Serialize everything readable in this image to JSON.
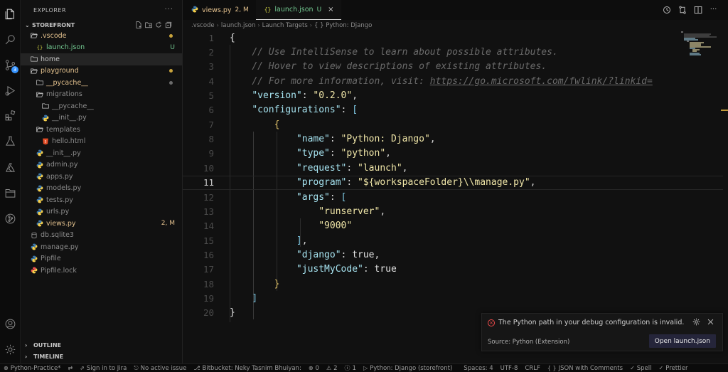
{
  "sidebar": {
    "title": "EXPLORER",
    "more": "···",
    "project": "STOREFRONT",
    "items": [
      {
        "label": ".vscode",
        "kind": "folder-open",
        "depth": 0,
        "color": "mod",
        "dot": "#c9a43c"
      },
      {
        "label": "launch.json",
        "kind": "json",
        "depth": 1,
        "color": "untracked",
        "status": "U",
        "statusColor": "#73c991"
      },
      {
        "label": "home",
        "kind": "folder",
        "depth": 0,
        "color": "normal",
        "selected": true
      },
      {
        "label": "playground",
        "kind": "folder-open",
        "depth": 0,
        "color": "mod",
        "dot": "#c9a43c"
      },
      {
        "label": "__pycache__",
        "kind": "folder",
        "depth": 1,
        "color": "mod",
        "dot": "#6b6b6b"
      },
      {
        "label": "migrations",
        "kind": "folder-open",
        "depth": 1,
        "color": "dim"
      },
      {
        "label": "__pycache__",
        "kind": "folder",
        "depth": 2,
        "color": "dim"
      },
      {
        "label": "__init__.py",
        "kind": "py",
        "depth": 2,
        "color": "dim"
      },
      {
        "label": "templates",
        "kind": "folder-open",
        "depth": 1,
        "color": "dim"
      },
      {
        "label": "hello.html",
        "kind": "html",
        "depth": 2,
        "color": "dim"
      },
      {
        "label": "__init__.py",
        "kind": "py",
        "depth": 1,
        "color": "dim"
      },
      {
        "label": "admin.py",
        "kind": "py",
        "depth": 1,
        "color": "dim"
      },
      {
        "label": "apps.py",
        "kind": "py",
        "depth": 1,
        "color": "dim"
      },
      {
        "label": "models.py",
        "kind": "py",
        "depth": 1,
        "color": "dim"
      },
      {
        "label": "tests.py",
        "kind": "py",
        "depth": 1,
        "color": "dim"
      },
      {
        "label": "urls.py",
        "kind": "py",
        "depth": 1,
        "color": "dim"
      },
      {
        "label": "views.py",
        "kind": "py",
        "depth": 1,
        "color": "mod",
        "status": "2, M",
        "statusColor": "#e2c08d"
      },
      {
        "label": "db.sqlite3",
        "kind": "db",
        "depth": 0,
        "color": "dim"
      },
      {
        "label": "manage.py",
        "kind": "py",
        "depth": 0,
        "color": "dim"
      },
      {
        "label": "Pipfile",
        "kind": "pip",
        "depth": 0,
        "color": "dim"
      },
      {
        "label": "Pipfile.lock",
        "kind": "lock",
        "depth": 0,
        "color": "dim"
      }
    ],
    "outline": "OUTLINE",
    "timeline": "TIMELINE"
  },
  "activity": {
    "scm_badge": "3"
  },
  "tabs": [
    {
      "label": "views.py",
      "status": "2, M",
      "icon": "py",
      "active": false
    },
    {
      "label": "launch.json",
      "status": "U",
      "icon": "json",
      "active": true,
      "close": "×"
    }
  ],
  "breadcrumb": [
    ".vscode",
    "launch.json",
    "Launch Targets",
    "{ } Python: Django"
  ],
  "code": {
    "lines": [
      "1",
      "2",
      "3",
      "4",
      "5",
      "6",
      "7",
      "8",
      "9",
      "10",
      "11",
      "12",
      "13",
      "14",
      "15",
      "16",
      "17",
      "18",
      "19",
      "20"
    ],
    "current_line": 11,
    "comment1": "// Use IntelliSense to learn about possible attributes.",
    "comment2": "// Hover to view descriptions of existing attributes.",
    "comment3_prefix": "// For more information, visit: ",
    "comment3_url": "https://go.microsoft.com/fwlink/?linkid=",
    "version_key": "\"version\"",
    "version_val": "\"0.2.0\"",
    "configs_key": "\"configurations\"",
    "name_key": "\"name\"",
    "name_val": "\"Python: Django\"",
    "type_key": "\"type\"",
    "type_val": "\"python\"",
    "request_key": "\"request\"",
    "request_val": "\"launch\"",
    "program_key": "\"program\"",
    "program_val": "\"${workspaceFolder}\\\\manage.py\"",
    "args_key": "\"args\"",
    "arg1": "\"runserver\"",
    "arg2": "\"9000\"",
    "django_key": "\"django\"",
    "django_val": "true",
    "jmc_key": "\"justMyCode\"",
    "jmc_val": "true"
  },
  "notification": {
    "message": "The Python path in your debug configuration is invalid.",
    "source": "Source: Python (Extension)",
    "button": "Open launch.json"
  },
  "statusbar": [
    {
      "icon": "⊗",
      "label": "Python-Practice*"
    },
    {
      "icon": "⇄",
      "label": ""
    },
    {
      "icon": "⇗",
      "label": "Sign in to Jira"
    },
    {
      "icon": "⎋",
      "label": "No active issue"
    },
    {
      "icon": "⎇",
      "label": "Bitbucket: Neky Tasnim Bhuiyan:"
    },
    {
      "icon": "⊗",
      "label": "0"
    },
    {
      "icon": "⚠",
      "label": "2"
    },
    {
      "icon": "ⓘ",
      "label": "1"
    },
    {
      "icon": "▷",
      "label": "Python: Django (storefront)"
    },
    {
      "icon": "",
      "label": "Spaces: 4"
    },
    {
      "icon": "",
      "label": "UTF-8"
    },
    {
      "icon": "",
      "label": "CRLF"
    },
    {
      "icon": "{ }",
      "label": "JSON with Comments"
    },
    {
      "icon": "✓",
      "label": "Spell"
    },
    {
      "icon": "✓",
      "label": "Prettier"
    }
  ]
}
